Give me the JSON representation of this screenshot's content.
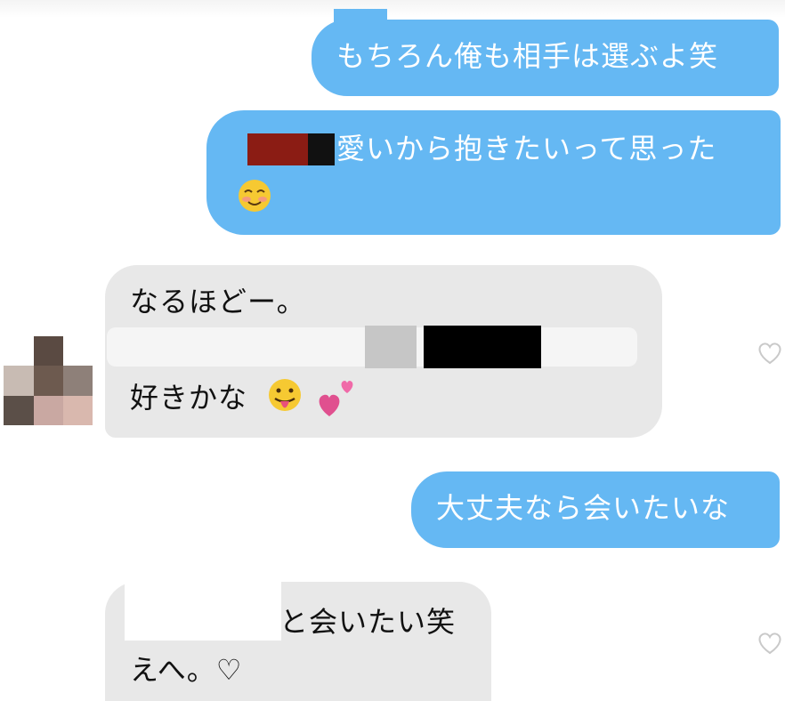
{
  "messages": [
    {
      "side": "out",
      "text": "もちろん俺も相手は選ぶよ笑"
    },
    {
      "side": "out",
      "text": "愛いから抱きたいって思った",
      "emoji": "smiling-blush-emoji"
    },
    {
      "side": "in",
      "line1": "なるほどー。",
      "line3": "好きかな",
      "emoji1": "tongue-out-emoji",
      "emoji2": "two-hearts-emoji"
    },
    {
      "side": "out",
      "text": "大丈夫なら会いたいな"
    },
    {
      "side": "in",
      "line1": "と会いたい笑",
      "line2": "えへ。♡"
    }
  ],
  "colors": {
    "outgoing": "#65b8f3",
    "incoming": "#e8e8e8"
  },
  "icons": [
    "like-heart-icon",
    "avatar"
  ]
}
